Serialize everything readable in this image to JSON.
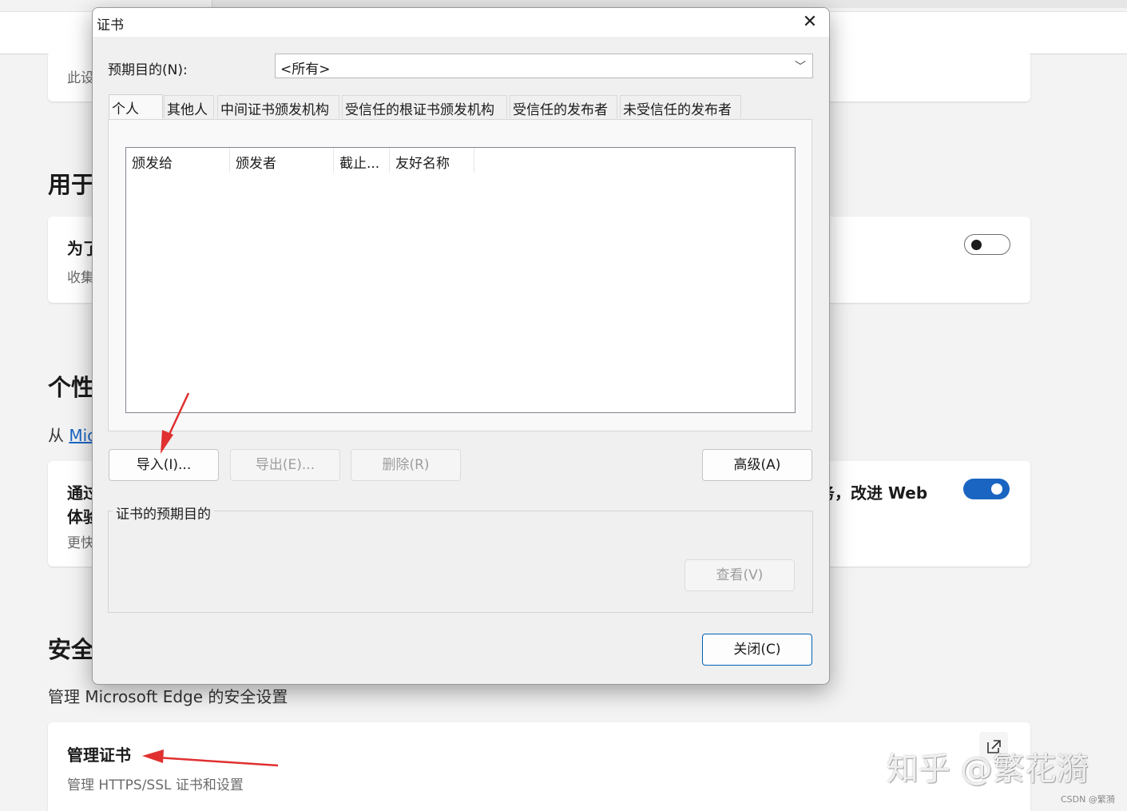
{
  "settings_page": {
    "card1_text": "此设",
    "section1_heading": "用于",
    "card2_title": "为了",
    "card2_sub": "收集",
    "section2_heading": "个性",
    "section2_prefix": "从",
    "section2_link": "Mic",
    "card3_line1": "通过",
    "card3_line2": "体验",
    "card3_sub": "更快",
    "card3_right_text": "务，改进 Web",
    "section3_heading": "安全",
    "section3_desc": "管理 Microsoft Edge 的安全设置",
    "manage_certs_title": "管理证书",
    "manage_certs_sub": "管理 HTTPS/SSL 证书和设置",
    "toggle1_state": "off",
    "toggle2_state": "on",
    "accent_color": "#1a65c2",
    "external_icon": "external-link-icon"
  },
  "dialog": {
    "title": "证书",
    "close_glyph": "✕",
    "purpose_label": "预期目的(N):",
    "purpose_value": "<所有>",
    "tabs": [
      {
        "label": "个人",
        "active": true
      },
      {
        "label": "其他人"
      },
      {
        "label": "中间证书颁发机构"
      },
      {
        "label": "受信任的根证书颁发机构"
      },
      {
        "label": "受信任的发布者"
      },
      {
        "label": "未受信任的发布者"
      }
    ],
    "columns": [
      "颁发给",
      "颁发者",
      "截止...",
      "友好名称"
    ],
    "buttons": {
      "import": "导入(I)...",
      "export": "导出(E)...",
      "remove": "删除(R)",
      "advanced": "高级(A)",
      "view": "查看(V)",
      "close": "关闭(C)"
    },
    "group_label": "证书的预期目的"
  },
  "watermark": "知乎 @繁花漪",
  "csdn_mark": "CSDN @繁漪"
}
